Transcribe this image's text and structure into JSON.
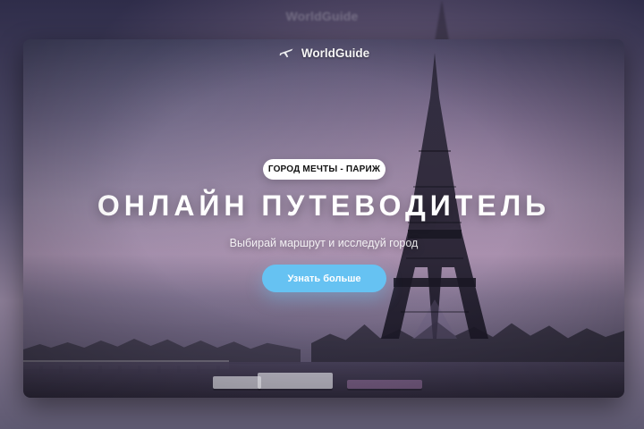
{
  "outer_background": {
    "brand_text": "WorldGuide"
  },
  "header": {
    "brand_text": "WorldGuide",
    "brand_icon": "airplane-icon"
  },
  "hero": {
    "pill_text": "ГОРОД МЕЧТЫ - ПАРИЖ",
    "headline": "ОНЛАЙН ПУТЕВОДИТЕЛЬ",
    "subtitle": "Выбирай маршрут и исследуй город",
    "cta_label": "Узнать больше"
  },
  "colors": {
    "cta_blue": "#66c2f2",
    "pill_white": "#ffffff",
    "text_white": "#ffffff"
  }
}
